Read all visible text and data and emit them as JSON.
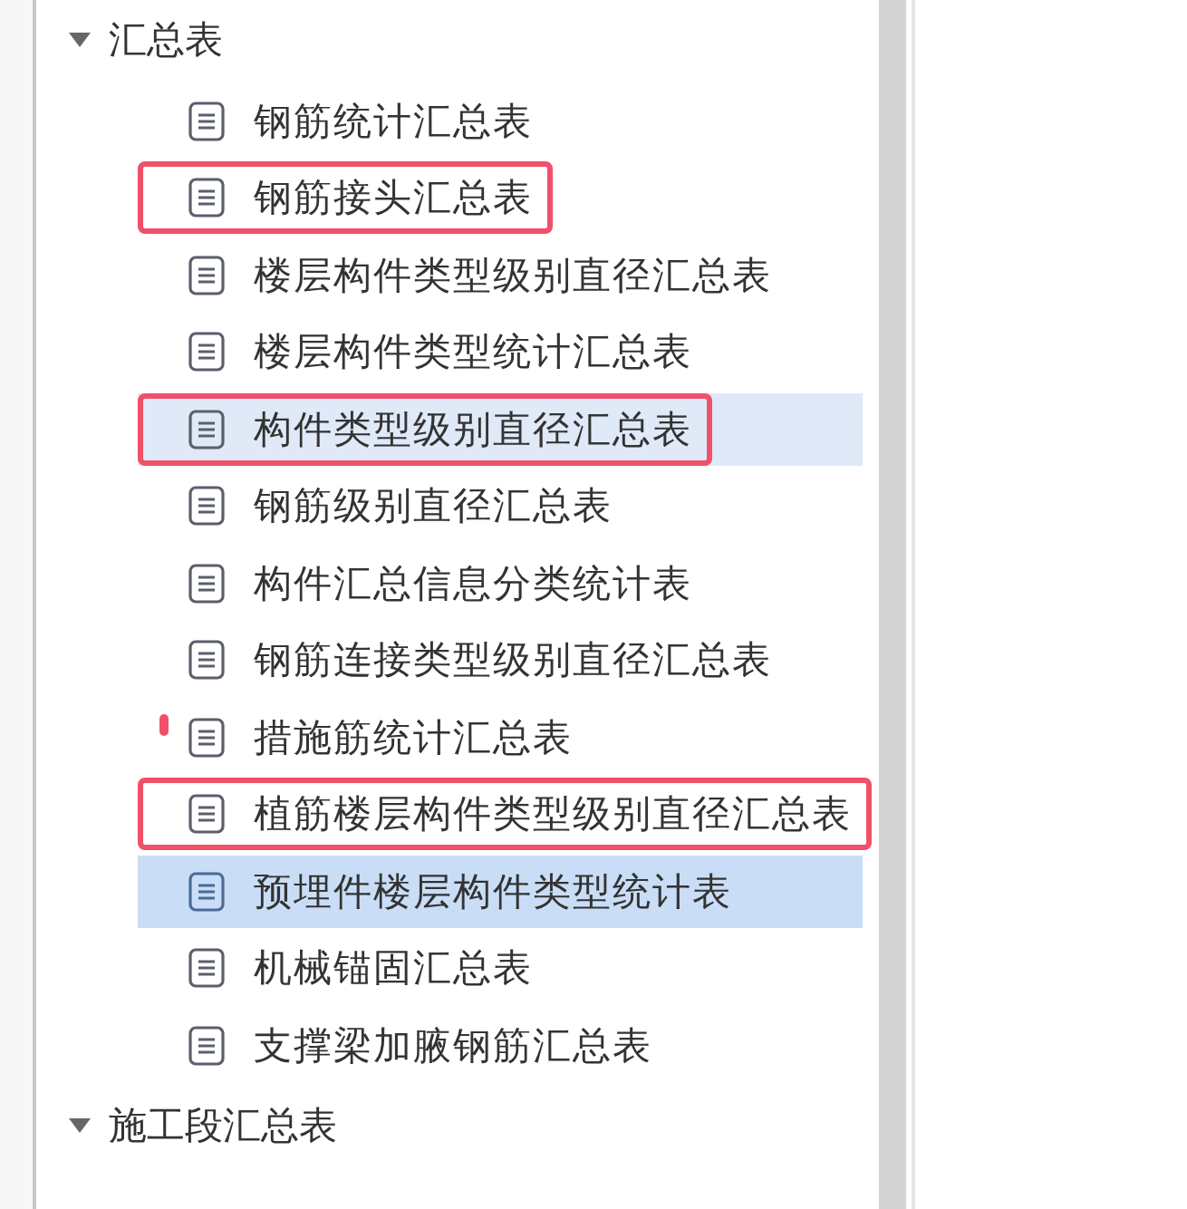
{
  "tree": [
    {
      "label": "汇总表",
      "expanded": true,
      "children": [
        {
          "label": "钢筋统计汇总表",
          "selected": false,
          "hovered": false,
          "annotated": false
        },
        {
          "label": "钢筋接头汇总表",
          "selected": false,
          "hovered": false,
          "annotated": true
        },
        {
          "label": "楼层构件类型级别直径汇总表",
          "selected": false,
          "hovered": false,
          "annotated": false
        },
        {
          "label": "楼层构件类型统计汇总表",
          "selected": false,
          "hovered": false,
          "annotated": false
        },
        {
          "label": "构件类型级别直径汇总表",
          "selected": false,
          "hovered": true,
          "annotated": true
        },
        {
          "label": "钢筋级别直径汇总表",
          "selected": false,
          "hovered": false,
          "annotated": false
        },
        {
          "label": "构件汇总信息分类统计表",
          "selected": false,
          "hovered": false,
          "annotated": false
        },
        {
          "label": "钢筋连接类型级别直径汇总表",
          "selected": false,
          "hovered": false,
          "annotated": false
        },
        {
          "label": "措施筋统计汇总表",
          "selected": false,
          "hovered": false,
          "annotated": false
        },
        {
          "label": "植筋楼层构件类型级别直径汇总表",
          "selected": false,
          "hovered": false,
          "annotated": true
        },
        {
          "label": "预埋件楼层构件类型统计表",
          "selected": true,
          "hovered": false,
          "annotated": false
        },
        {
          "label": "机械锚固汇总表",
          "selected": false,
          "hovered": false,
          "annotated": false
        },
        {
          "label": "支撑梁加腋钢筋汇总表",
          "selected": false,
          "hovered": false,
          "annotated": false
        }
      ]
    },
    {
      "label": "施工段汇总表",
      "expanded": true
    }
  ]
}
